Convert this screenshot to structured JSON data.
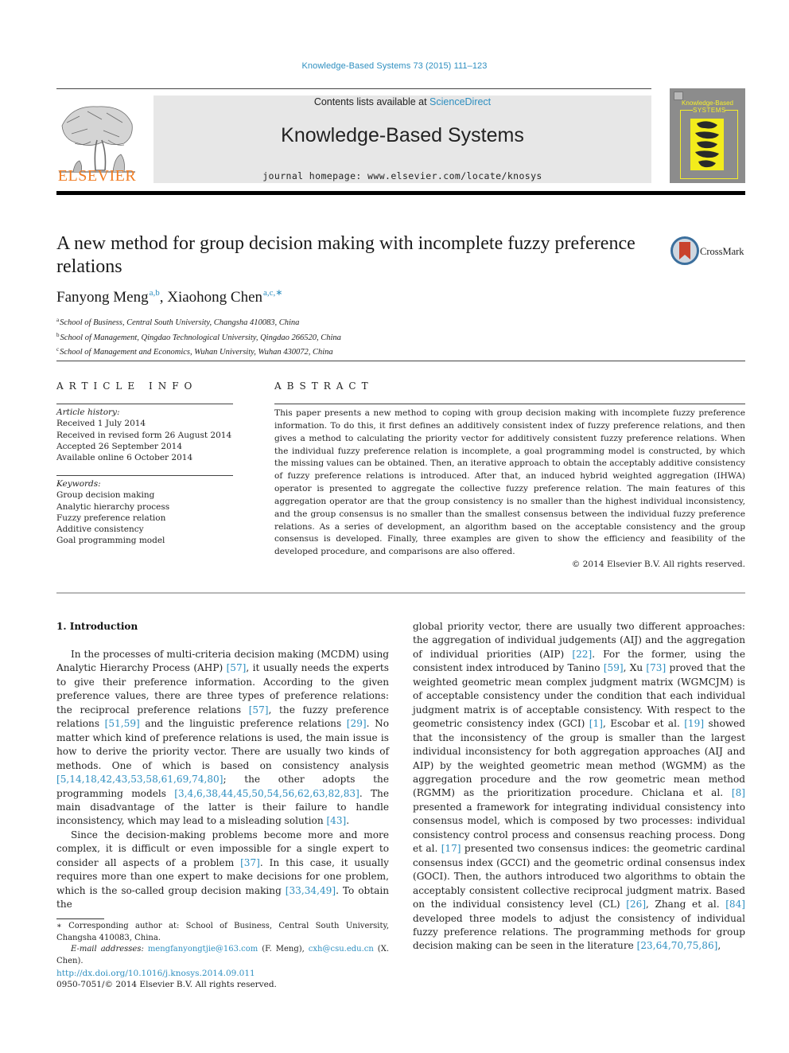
{
  "header": {
    "citation": "Knowledge-Based Systems 73 (2015) 111–123",
    "contents_prefix": "Contents lists available at ",
    "contents_link": "ScienceDirect",
    "journal_name": "Knowledge-Based Systems",
    "homepage_prefix": "journal homepage: ",
    "homepage_url": "www.elsevier.com/locate/knosys",
    "publisher_logo_text": "ELSEVIER",
    "cover_title_line1": "Knowledge-Based",
    "cover_title_line2": "SYSTEMS",
    "crossmark_label": "CrossMark",
    "colors": {
      "link": "#2e8fc0",
      "elsevier_orange": "#f07c22",
      "banner_grey": "#e7e7e7",
      "cover_grey": "#8c8c8c",
      "cover_yellow": "#f5ee2a"
    }
  },
  "article": {
    "title": "A new method for group decision making with incomplete fuzzy preference relations",
    "authors": [
      {
        "name": "Fanyong Meng",
        "sup": "a,b"
      },
      {
        "name": "Xiaohong Chen",
        "sup": "a,c,∗"
      }
    ],
    "author_separator": ", ",
    "affiliations": [
      {
        "key": "a",
        "text": "School of Business, Central South University, Changsha 410083, China"
      },
      {
        "key": "b",
        "text": "School of Management, Qingdao Technological University, Qingdao 266520, China"
      },
      {
        "key": "c",
        "text": "School of Management and Economics, Wuhan University, Wuhan 430072, China"
      }
    ]
  },
  "article_info": {
    "heading": "ARTICLE INFO",
    "history_label": "Article history:",
    "history": [
      "Received 1 July 2014",
      "Received in revised form 26 August 2014",
      "Accepted 26 September 2014",
      "Available online 6 October 2014"
    ],
    "keywords_label": "Keywords:",
    "keywords": [
      "Group decision making",
      "Analytic hierarchy process",
      "Fuzzy preference relation",
      "Additive consistency",
      "Goal programming model"
    ]
  },
  "abstract": {
    "heading": "ABSTRACT",
    "text": "This paper presents a new method to coping with group decision making with incomplete fuzzy preference information. To do this, it first defines an additively consistent index of fuzzy preference relations, and then gives a method to calculating the priority vector for additively consistent fuzzy preference relations. When the individual fuzzy preference relation is incomplete, a goal programming model is constructed, by which the missing values can be obtained. Then, an iterative approach to obtain the acceptably additive consistency of fuzzy preference relations is introduced. After that, an induced hybrid weighted aggregation (IHWA) operator is presented to aggregate the collective fuzzy preference relation. The main features of this aggregation operator are that the group consistency is no smaller than the highest individual inconsistency, and the group consensus is no smaller than the smallest consensus between the individual fuzzy preference relations. As a series of development, an algorithm based on the acceptable consistency and the group consensus is developed. Finally, three examples are given to show the efficiency and feasibility of the developed procedure, and comparisons are also offered.",
    "copyright": "© 2014 Elsevier B.V. All rights reserved."
  },
  "body": {
    "section_heading": "1. Introduction",
    "left_paragraphs": [
      [
        {
          "t": "In the processes of multi-criteria decision making (MCDM) using Analytic Hierarchy Process (AHP) "
        },
        {
          "ref": "[57]"
        },
        {
          "t": ", it usually needs the experts to give their preference information. According to the given preference values, there are three types of preference relations: the reciprocal preference relations "
        },
        {
          "ref": "[57]"
        },
        {
          "t": ", the fuzzy preference relations "
        },
        {
          "ref": "[51,59]"
        },
        {
          "t": " and the linguistic preference relations "
        },
        {
          "ref": "[29]"
        },
        {
          "t": ". No matter which kind of preference relations is used, the main issue is how to derive the priority vector. There are usually two kinds of methods. One of which is based on consistency analysis "
        },
        {
          "ref": "[5,14,18,42,43,53,58,61,69,74,80]"
        },
        {
          "t": "; the other adopts the programming models "
        },
        {
          "ref": "[3,4,6,38,44,45,50,54,56,62,63,82,83]"
        },
        {
          "t": ". The main disadvantage of the latter is their failure to handle inconsistency, which may lead to a misleading solution "
        },
        {
          "ref": "[43]"
        },
        {
          "t": "."
        }
      ],
      [
        {
          "t": "Since the decision-making problems become more and more complex, it is difficult or even impossible for a single expert to consider all aspects of a problem "
        },
        {
          "ref": "[37]"
        },
        {
          "t": ". In this case, it usually requires more than one expert to make decisions for one problem, which is the so-called group decision making "
        },
        {
          "ref": "[33,34,49]"
        },
        {
          "t": ". To obtain the"
        }
      ]
    ],
    "right_paragraphs": [
      [
        {
          "t": "global priority vector, there are usually two different approaches: the aggregation of individual judgements (AIJ) and the aggregation of individual priorities (AIP) "
        },
        {
          "ref": "[22]"
        },
        {
          "t": ". For the former, using the consistent index introduced by Tanino "
        },
        {
          "ref": "[59]"
        },
        {
          "t": ", Xu "
        },
        {
          "ref": "[73]"
        },
        {
          "t": " proved that the weighted geometric mean complex judgment matrix (WGMCJM) is of acceptable consistency under the condition that each individual judgment matrix is of acceptable consistency. With respect to the geometric consistency index (GCI) "
        },
        {
          "ref": "[1]"
        },
        {
          "t": ", Escobar et al. "
        },
        {
          "ref": "[19]"
        },
        {
          "t": " showed that the inconsistency of the group is smaller than the largest individual inconsistency for both aggregation approaches (AIJ and AIP) by the weighted geometric mean method (WGMM) as the aggregation procedure and the row geometric mean method (RGMM) as the prioritization procedure. Chiclana et al. "
        },
        {
          "ref": "[8]"
        },
        {
          "t": " presented a framework for integrating individual consistency into consensus model, which is composed by two processes: individual consistency control process and consensus reaching process. Dong et al. "
        },
        {
          "ref": "[17]"
        },
        {
          "t": " presented two consensus indices: the geometric cardinal consensus index (GCCI) and the geometric ordinal consensus index (GOCI). Then, the authors introduced two algorithms to obtain the acceptably consistent collective reciprocal judgment matrix. Based on the individual consistency level (CL) "
        },
        {
          "ref": "[26]"
        },
        {
          "t": ", Zhang et al. "
        },
        {
          "ref": "[84]"
        },
        {
          "t": " developed three models to adjust the consistency of individual fuzzy preference relations. The programming methods for group decision making can be seen in the literature "
        },
        {
          "ref": "[23,64,70,75,86]"
        },
        {
          "t": ","
        }
      ]
    ]
  },
  "footnote": {
    "corresponding": "∗ Corresponding author at: School of Business, Central South University, Changsha 410083, China.",
    "email_label": "E-mail addresses: ",
    "emails": [
      {
        "address": "mengfanyongtjie@163.com",
        "who": " (F. Meng), "
      },
      {
        "address": "cxh@csu.edu.cn",
        "who": " (X. Chen)."
      }
    ],
    "doi": "http://dx.doi.org/10.1016/j.knosys.2014.09.011",
    "issn": "0950-7051/© 2014 Elsevier B.V. All rights reserved."
  }
}
